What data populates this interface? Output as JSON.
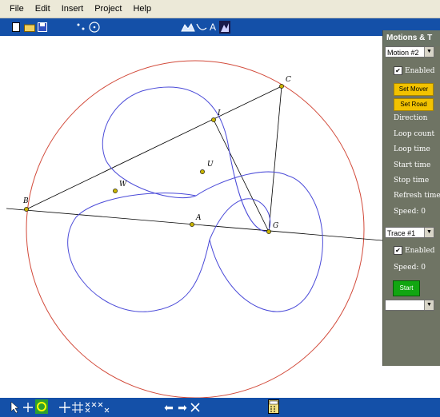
{
  "menu": [
    "File",
    "Edit",
    "Insert",
    "Project",
    "Help"
  ],
  "panel": {
    "title": "Motions & T",
    "motion_select": "Motion #2",
    "enabled1": "Enabled",
    "set_mover": "Set Mover",
    "set_road": "Set Road",
    "direction": "Direction",
    "loop_count": "Loop count",
    "loop_time": "Loop time",
    "start_time": "Start time",
    "stop_time": "Stop time",
    "refresh_time": "Refresh time",
    "speed1": "Speed:  0",
    "trace_select": "Trace #1",
    "enabled2": "Enabled",
    "speed2": "Speed:  0",
    "start": "Start"
  },
  "points": {
    "C": "C",
    "I": "I",
    "U": "U",
    "W": "W",
    "B": "B",
    "A": "A",
    "G": "G"
  },
  "colors": {
    "circle": "#d24a3a",
    "curve": "#4a4ad8",
    "line": "#000000",
    "point": "#c8b400",
    "toolbar": "#1450a8",
    "panel": "#6f7464"
  },
  "icons": [
    "new-file-icon",
    "open-folder-icon",
    "save-icon",
    "pointer-icon",
    "circle-tool-icon",
    "curve-tool-icon",
    "text-tool-icon",
    "image-tool-icon",
    "select-arrow-icon",
    "move-icon",
    "rotate-icon",
    "grid-icon",
    "arrow-left-icon",
    "arrow-right-icon",
    "delete-icon",
    "calculator-icon"
  ]
}
